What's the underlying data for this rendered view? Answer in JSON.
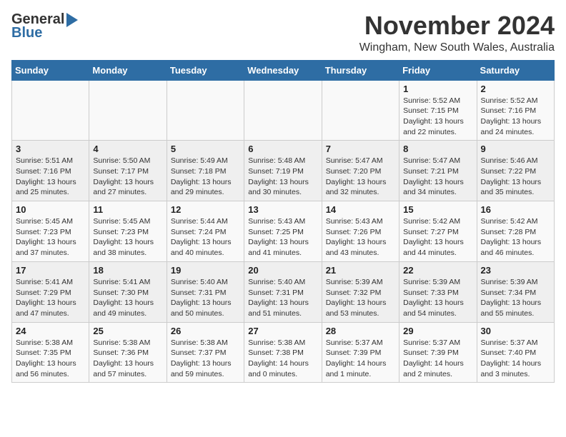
{
  "header": {
    "logo_general": "General",
    "logo_blue": "Blue",
    "title": "November 2024",
    "location": "Wingham, New South Wales, Australia"
  },
  "calendar": {
    "days_of_week": [
      "Sunday",
      "Monday",
      "Tuesday",
      "Wednesday",
      "Thursday",
      "Friday",
      "Saturday"
    ],
    "weeks": [
      [
        {
          "day": "",
          "info": ""
        },
        {
          "day": "",
          "info": ""
        },
        {
          "day": "",
          "info": ""
        },
        {
          "day": "",
          "info": ""
        },
        {
          "day": "",
          "info": ""
        },
        {
          "day": "1",
          "info": "Sunrise: 5:52 AM\nSunset: 7:15 PM\nDaylight: 13 hours\nand 22 minutes."
        },
        {
          "day": "2",
          "info": "Sunrise: 5:52 AM\nSunset: 7:16 PM\nDaylight: 13 hours\nand 24 minutes."
        }
      ],
      [
        {
          "day": "3",
          "info": "Sunrise: 5:51 AM\nSunset: 7:16 PM\nDaylight: 13 hours\nand 25 minutes."
        },
        {
          "day": "4",
          "info": "Sunrise: 5:50 AM\nSunset: 7:17 PM\nDaylight: 13 hours\nand 27 minutes."
        },
        {
          "day": "5",
          "info": "Sunrise: 5:49 AM\nSunset: 7:18 PM\nDaylight: 13 hours\nand 29 minutes."
        },
        {
          "day": "6",
          "info": "Sunrise: 5:48 AM\nSunset: 7:19 PM\nDaylight: 13 hours\nand 30 minutes."
        },
        {
          "day": "7",
          "info": "Sunrise: 5:47 AM\nSunset: 7:20 PM\nDaylight: 13 hours\nand 32 minutes."
        },
        {
          "day": "8",
          "info": "Sunrise: 5:47 AM\nSunset: 7:21 PM\nDaylight: 13 hours\nand 34 minutes."
        },
        {
          "day": "9",
          "info": "Sunrise: 5:46 AM\nSunset: 7:22 PM\nDaylight: 13 hours\nand 35 minutes."
        }
      ],
      [
        {
          "day": "10",
          "info": "Sunrise: 5:45 AM\nSunset: 7:23 PM\nDaylight: 13 hours\nand 37 minutes."
        },
        {
          "day": "11",
          "info": "Sunrise: 5:45 AM\nSunset: 7:23 PM\nDaylight: 13 hours\nand 38 minutes."
        },
        {
          "day": "12",
          "info": "Sunrise: 5:44 AM\nSunset: 7:24 PM\nDaylight: 13 hours\nand 40 minutes."
        },
        {
          "day": "13",
          "info": "Sunrise: 5:43 AM\nSunset: 7:25 PM\nDaylight: 13 hours\nand 41 minutes."
        },
        {
          "day": "14",
          "info": "Sunrise: 5:43 AM\nSunset: 7:26 PM\nDaylight: 13 hours\nand 43 minutes."
        },
        {
          "day": "15",
          "info": "Sunrise: 5:42 AM\nSunset: 7:27 PM\nDaylight: 13 hours\nand 44 minutes."
        },
        {
          "day": "16",
          "info": "Sunrise: 5:42 AM\nSunset: 7:28 PM\nDaylight: 13 hours\nand 46 minutes."
        }
      ],
      [
        {
          "day": "17",
          "info": "Sunrise: 5:41 AM\nSunset: 7:29 PM\nDaylight: 13 hours\nand 47 minutes."
        },
        {
          "day": "18",
          "info": "Sunrise: 5:41 AM\nSunset: 7:30 PM\nDaylight: 13 hours\nand 49 minutes."
        },
        {
          "day": "19",
          "info": "Sunrise: 5:40 AM\nSunset: 7:31 PM\nDaylight: 13 hours\nand 50 minutes."
        },
        {
          "day": "20",
          "info": "Sunrise: 5:40 AM\nSunset: 7:31 PM\nDaylight: 13 hours\nand 51 minutes."
        },
        {
          "day": "21",
          "info": "Sunrise: 5:39 AM\nSunset: 7:32 PM\nDaylight: 13 hours\nand 53 minutes."
        },
        {
          "day": "22",
          "info": "Sunrise: 5:39 AM\nSunset: 7:33 PM\nDaylight: 13 hours\nand 54 minutes."
        },
        {
          "day": "23",
          "info": "Sunrise: 5:39 AM\nSunset: 7:34 PM\nDaylight: 13 hours\nand 55 minutes."
        }
      ],
      [
        {
          "day": "24",
          "info": "Sunrise: 5:38 AM\nSunset: 7:35 PM\nDaylight: 13 hours\nand 56 minutes."
        },
        {
          "day": "25",
          "info": "Sunrise: 5:38 AM\nSunset: 7:36 PM\nDaylight: 13 hours\nand 57 minutes."
        },
        {
          "day": "26",
          "info": "Sunrise: 5:38 AM\nSunset: 7:37 PM\nDaylight: 13 hours\nand 59 minutes."
        },
        {
          "day": "27",
          "info": "Sunrise: 5:38 AM\nSunset: 7:38 PM\nDaylight: 14 hours\nand 0 minutes."
        },
        {
          "day": "28",
          "info": "Sunrise: 5:37 AM\nSunset: 7:39 PM\nDaylight: 14 hours\nand 1 minute."
        },
        {
          "day": "29",
          "info": "Sunrise: 5:37 AM\nSunset: 7:39 PM\nDaylight: 14 hours\nand 2 minutes."
        },
        {
          "day": "30",
          "info": "Sunrise: 5:37 AM\nSunset: 7:40 PM\nDaylight: 14 hours\nand 3 minutes."
        }
      ]
    ]
  }
}
